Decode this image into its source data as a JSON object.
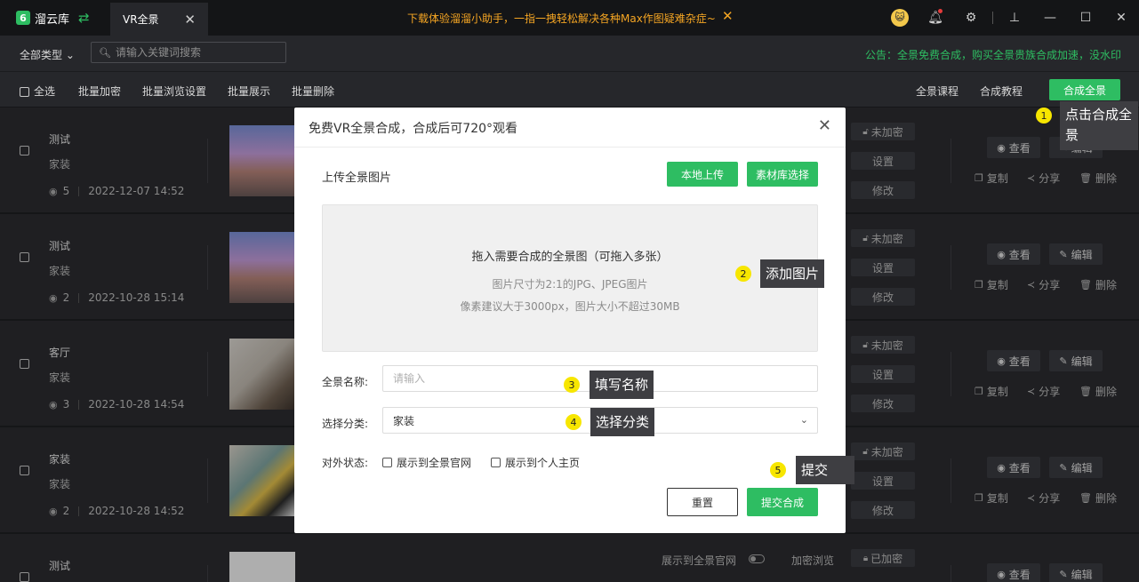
{
  "titlebar": {
    "logo_text": "溜云库",
    "tab_label": "VR全景",
    "promo": "下载体验溜溜小助手，一指一拽轻松解决各种Max作图疑难杂症~",
    "avatar_glyph": "😺"
  },
  "filter": {
    "type_label": "全部类型",
    "search_placeholder": "请输入关键词搜索",
    "notice": "公告：全景免费合成，购买全景贵族合成加速，没水印"
  },
  "actions": {
    "select_all": "全选",
    "batch_encrypt": "批量加密",
    "batch_browse": "批量浏览设置",
    "batch_show": "批量展示",
    "batch_delete": "批量删除",
    "course": "全景课程",
    "tutorial": "合成教程",
    "compose": "合成全景"
  },
  "row_labels": {
    "unencrypted": "未加密",
    "encrypted": "已加密",
    "settings": "设置",
    "modify": "修改",
    "view": "查看",
    "edit": "编辑",
    "copy": "复制",
    "share": "分享",
    "delete": "删除",
    "show_site": "展示到全景官网",
    "enc_browse": "加密浏览"
  },
  "rows": [
    {
      "title": "测试",
      "category": "家装",
      "views": "5",
      "date": "2022-12-07 14:52"
    },
    {
      "title": "测试",
      "category": "家装",
      "views": "2",
      "date": "2022-10-28 15:14"
    },
    {
      "title": "客厅",
      "category": "家装",
      "views": "3",
      "date": "2022-10-28 14:54"
    },
    {
      "title": "家装",
      "category": "家装",
      "views": "2",
      "date": "2022-10-28 14:52"
    },
    {
      "title": "测试"
    }
  ],
  "modal": {
    "title": "免费VR全景合成，合成后可720°观看",
    "upload_label": "上传全景图片",
    "local_upload": "本地上传",
    "library_select": "素材库选择",
    "drop_main": "拖入需要合成的全景图（可拖入多张）",
    "drop_sub1": "图片尺寸为2:1的JPG、JPEG图片",
    "drop_sub2": "像素建议大于3000px，图片大小不超过30MB",
    "name_label": "全景名称:",
    "name_placeholder": "请输入",
    "category_label": "选择分类:",
    "category_value": "家装",
    "status_label": "对外状态:",
    "show_official": "展示到全景官网",
    "show_personal": "展示到个人主页",
    "reset": "重置",
    "submit": "提交合成"
  },
  "annotations": [
    {
      "num": "1",
      "text": "点击合成全景"
    },
    {
      "num": "2",
      "text": "添加图片"
    },
    {
      "num": "3",
      "text": "填写名称"
    },
    {
      "num": "4",
      "text": "选择分类"
    },
    {
      "num": "5",
      "text": "提交"
    }
  ],
  "colors": {
    "accent": "#2ebd62",
    "promo": "#f6a623",
    "annotation": "#f7e600"
  }
}
